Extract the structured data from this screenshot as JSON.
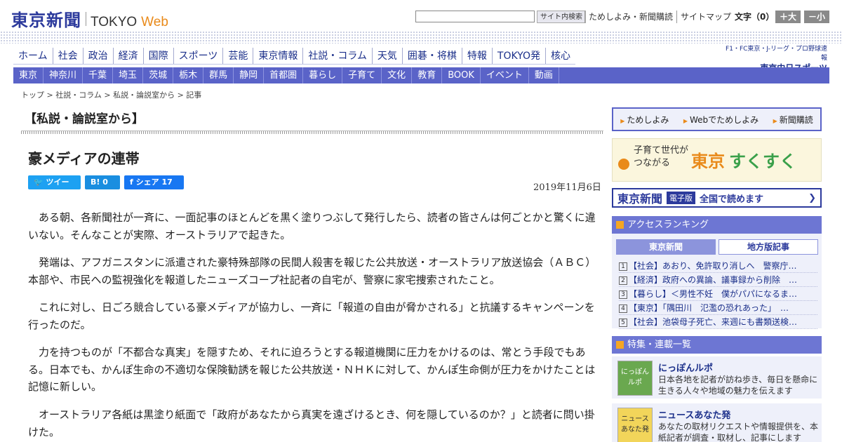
{
  "header": {
    "logo_jp": "東京新聞",
    "logo_tokyo": "TOKYO",
    "logo_web": "Web",
    "search_placeholder": "",
    "search_button": "サイト内検索",
    "links": [
      "ためしよみ・新聞購読",
      "サイトマップ"
    ],
    "fontsize_label": "文字（0）",
    "font_up": "＋大",
    "font_down": "－小"
  },
  "nav_main": [
    "ホーム",
    "社会",
    "政治",
    "経済",
    "国際",
    "スポーツ",
    "芸能",
    "東京情報",
    "社説・コラム",
    "天気",
    "囲碁・将棋",
    "特報",
    "TOKYO発",
    "核心"
  ],
  "chunichi": {
    "small": "F1・FC東京・J-リーグ・プロ野球速報",
    "big": "東京中日スポーツ"
  },
  "nav_sub": [
    "東京",
    "神奈川",
    "千葉",
    "埼玉",
    "茨城",
    "栃木",
    "群馬",
    "静岡",
    "首都圏",
    "暮らし",
    "子育て",
    "文化",
    "教育",
    "BOOK",
    "イベント",
    "動画"
  ],
  "breadcrumb": "トップ > 社説・コラム > 私説・論説室から > 記事",
  "article": {
    "section": "【私説・論説室から】",
    "headline": "豪メディアの連帯",
    "share_tweet": "ツイート",
    "share_hatena": "B! 0",
    "share_facebook": "シェア 17",
    "date": "2019年11月6日",
    "paragraphs": [
      "ある朝、各新聞社が一斉に、一面記事のほとんどを黒く塗りつぶして発行したら、読者の皆さんは何ごとかと驚くに違いない。そんなことが実際、オーストラリアで起きた。",
      "発端は、アフガニスタンに派遣された豪特殊部隊の民間人殺害を報じた公共放送・オーストラリア放送協会（ＡＢＣ）本部や、市民への監視強化を報道したニューズコープ社記者の自宅が、警察に家宅捜索されたこと。",
      "これに対し、日ごろ競合している豪メディアが協力し、一斉に「報道の自由が脅かされる」と抗議するキャンペーンを行ったのだ。",
      "力を持つものが「不都合な真実」を隠すため、それに迫ろうとする報道機関に圧力をかけるのは、常とう手段でもある。日本でも、かんぽ生命の不適切な保険勧誘を報じた公共放送・ＮＨＫに対して、かんぽ生命側が圧力をかけたことは記憶に新しい。",
      "オーストラリア各紙は黒塗り紙面で「政府があなたから真実を遠ざけるとき、何を隠しているのか？」と読者に問い掛けた。"
    ]
  },
  "sidebar": {
    "buttons": [
      "ためしよみ",
      "Webでためしよみ",
      "新聞購読"
    ],
    "sukusuku_sub": "子育て世代が\nつながる",
    "sukusuku_tokyo": "東京",
    "sukusuku_main": "すくすく",
    "denshi_name": "東京新聞",
    "denshi_badge": "電子版",
    "denshi_text": "全国で読めます",
    "ranking_title": "アクセスランキング",
    "ranking_tab1": "東京新聞",
    "ranking_tab2": "地方版記事",
    "ranking": [
      {
        "num": "1",
        "text": "【社会】あおり、免許取り消しへ　警察庁…"
      },
      {
        "num": "2",
        "text": "【経済】政府への異論、議事録から削除　…"
      },
      {
        "num": "3",
        "text": "【暮らし】＜男性不妊　僕がパパになるま…"
      },
      {
        "num": "4",
        "text": "【東京】「隅田川　氾濫の恐れあった」　…"
      },
      {
        "num": "5",
        "text": "【社会】池袋母子死亡、来週にも書類送検…"
      }
    ],
    "features_title": "特集・連載一覧",
    "features": [
      {
        "thumb": "にっぽん ルポ",
        "title": "にっぽんルポ",
        "desc": "日本各地を記者が訪ね歩き、毎日を懸命に生きる人々や地域の魅力を伝えます"
      },
      {
        "thumb": "ニュース あなた発",
        "title": "ニュースあなた発",
        "desc": "あなたの取材リクエストや情報提供を、本紙記者が調査・取材し、記事にします"
      }
    ]
  }
}
